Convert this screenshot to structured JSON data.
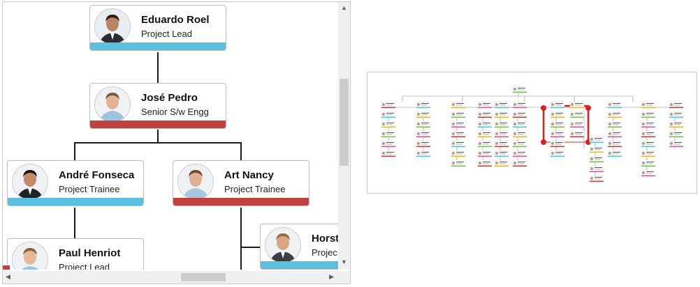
{
  "orgchart": {
    "nodes": [
      {
        "name": "Eduardo Roel",
        "role": "Project Lead",
        "band": "#5bc0de"
      },
      {
        "name": "José Pedro",
        "role": "Senior S/w Engg",
        "band": "#c0423f"
      },
      {
        "name": "André Fonseca",
        "role": "Project Trainee",
        "band": "#5bc0de"
      },
      {
        "name": "Art Nancy",
        "role": "Project Trainee",
        "band": "#c0423f"
      },
      {
        "name": "Paul Henriot",
        "role": "Project Lead",
        "band": "#c0423f"
      },
      {
        "name": "Horst",
        "role": "Projec",
        "band": "#5bc0de"
      }
    ]
  },
  "colors": {
    "accent_blue": "#5bc0de",
    "accent_red": "#c0423f",
    "overview_highlight": "#e02020"
  },
  "icons": {
    "scroll_up": "chevron-up-icon",
    "scroll_down": "chevron-down-icon",
    "scroll_left": "chevron-left-icon",
    "scroll_right": "chevron-right-icon"
  }
}
